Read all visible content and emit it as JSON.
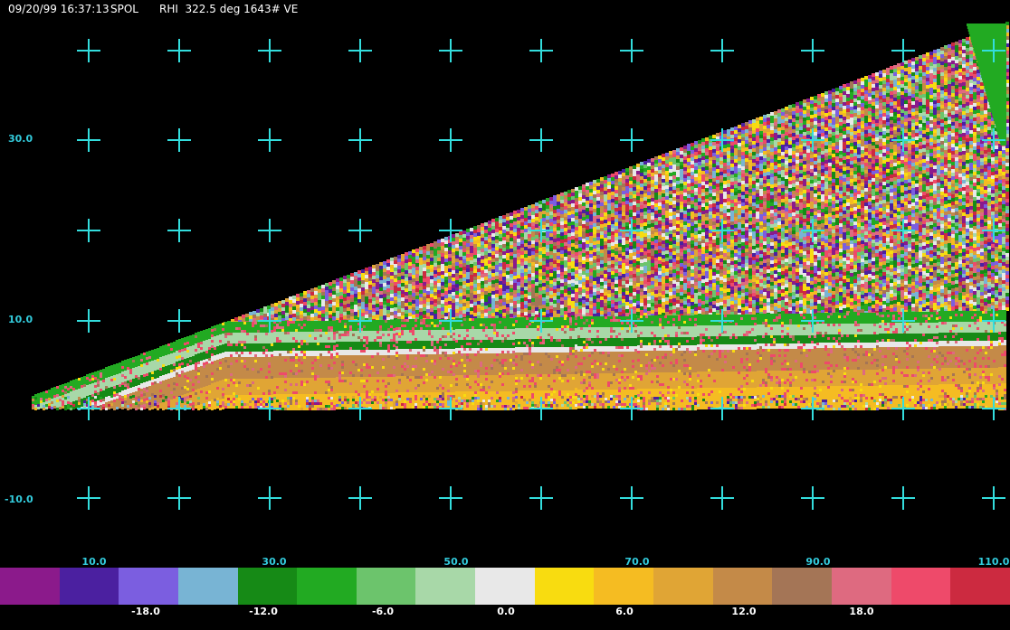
{
  "header": {
    "datetime": "09/20/99 16:37:13",
    "radar": "SPOL",
    "scan_info": "RHI  322.5 deg 1643# VE"
  },
  "axes": {
    "y_labels": [
      "30.0",
      "10.0",
      "-10.0"
    ],
    "x_labels": [
      "10.0",
      "30.0",
      "50.0",
      "70.0",
      "90.0",
      "110.0"
    ]
  },
  "colorbar": {
    "labels": [
      "-18.0",
      "-12.0",
      "-6.0",
      "0.0",
      "6.0",
      "12.0",
      "18.0"
    ],
    "colors": [
      "#8b1a8b",
      "#4b20a0",
      "#7b5ee0",
      "#78b4d4",
      "#168a16",
      "#22aa22",
      "#6cc46c",
      "#a8d8a8",
      "#e8e8e8",
      "#f8dc10",
      "#f5bc22",
      "#e0a535",
      "#c48a48",
      "#a47556",
      "#de6a80",
      "#ee4a6a",
      "#cc2a40"
    ]
  },
  "colors": {
    "grid": "#33dddd",
    "background": "#000000"
  }
}
